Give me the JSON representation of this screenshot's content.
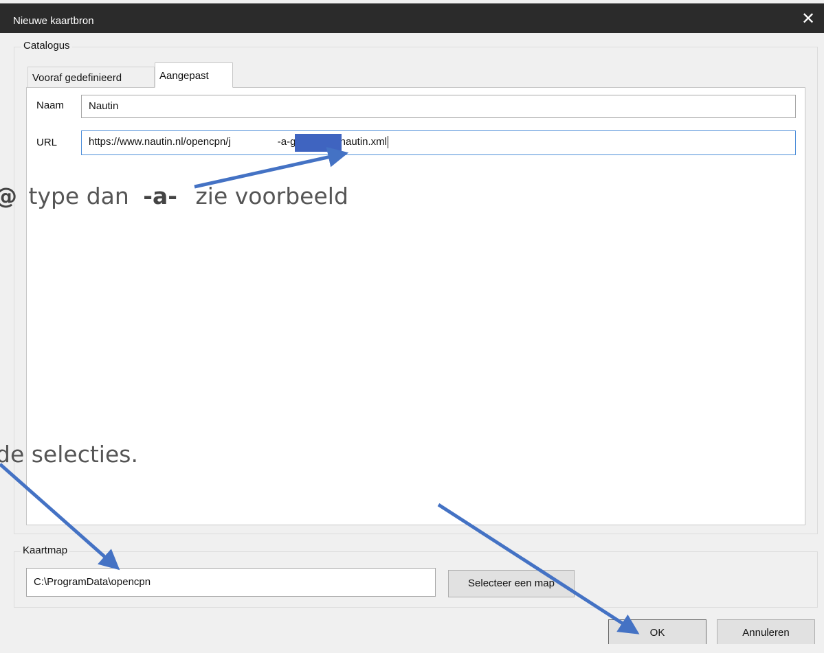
{
  "window": {
    "title": "Nieuwe kaartbron",
    "close_glyph": "✕"
  },
  "catalog": {
    "group_label": "Catalogus",
    "tabs": [
      {
        "label": "Vooraf gedefinieerd",
        "active": false
      },
      {
        "label": "Aangepast",
        "active": true
      }
    ],
    "name_label": "Naam",
    "name_value": "Nautin",
    "url_label": "URL",
    "url_value_start": "https://www.nautin.nl/opencpn/j",
    "url_value_end": "-a-gmail.com/nautin.xml"
  },
  "kaartmap": {
    "group_label": "Kaartmap",
    "path_value": "C:\\ProgramData\\opencpn",
    "select_button": "Selecteer een map"
  },
  "buttons": {
    "ok": "OK",
    "cancel": "Annuleren"
  },
  "annotations": {
    "line1_at": "@",
    "line1_a": "type dan",
    "line1_b": "-a-",
    "line1_c": "zie voorbeeld",
    "line2": "de selecties.",
    "arrow_color": "#4472c4"
  },
  "colors": {
    "titlebar": "#2b2b2b",
    "redaction": "#3f64c0",
    "focus_border": "#4a8cd8"
  }
}
